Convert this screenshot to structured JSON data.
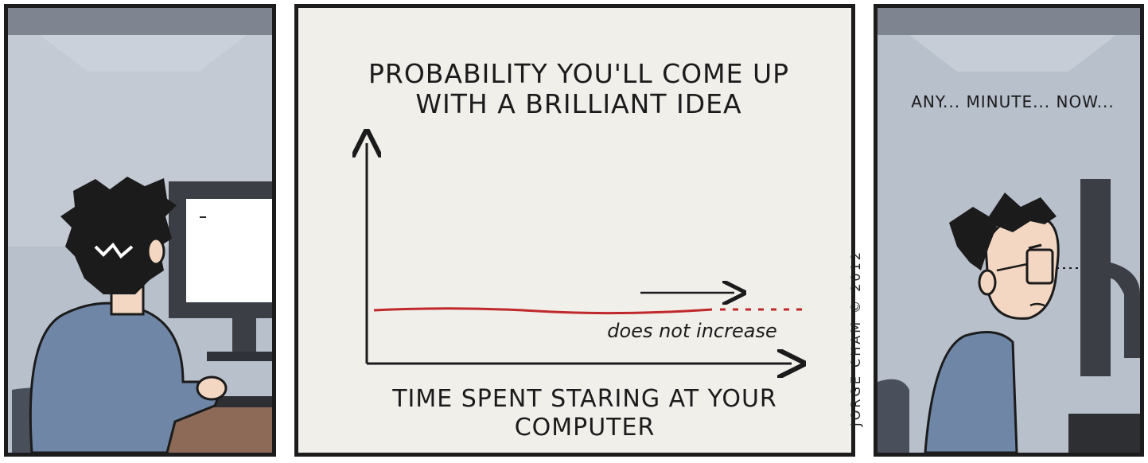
{
  "comic": {
    "panel2": {
      "title": "PROBABILITY YOU'LL COME UP WITH A BRILLIANT IDEA",
      "x_axis_label": "TIME SPENT STARING AT YOUR COMPUTER",
      "annotation": "does not increase",
      "line_color": "#c0282a"
    },
    "panel3": {
      "speech": "ANY... MINUTE... NOW..."
    },
    "credit": "JORGE CHAM © 2012"
  }
}
